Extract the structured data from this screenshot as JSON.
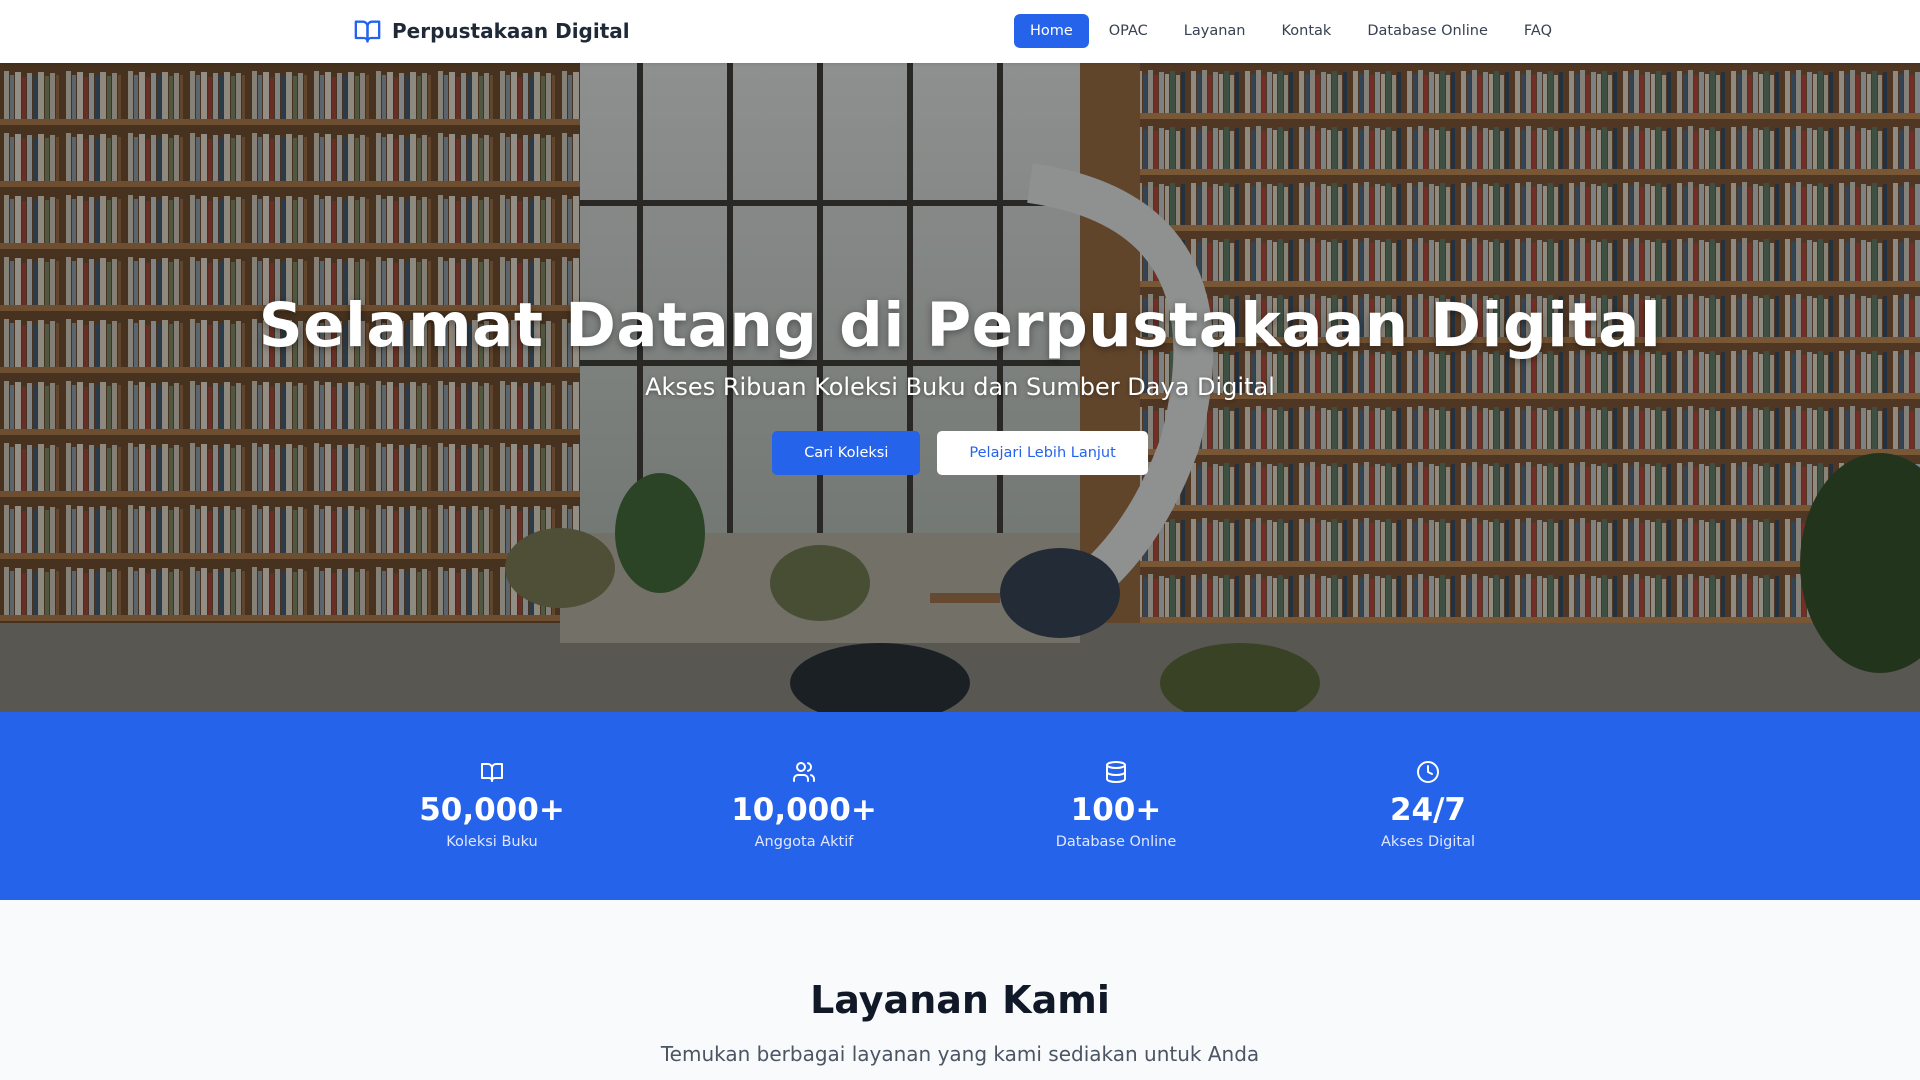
{
  "brand": {
    "name": "Perpustakaan Digital",
    "icon": "open-book-icon",
    "color": "#2563eb"
  },
  "nav": {
    "items": [
      {
        "label": "Home",
        "active": true
      },
      {
        "label": "OPAC",
        "active": false
      },
      {
        "label": "Layanan",
        "active": false
      },
      {
        "label": "Kontak",
        "active": false
      },
      {
        "label": "Database Online",
        "active": false
      },
      {
        "label": "FAQ",
        "active": false
      }
    ]
  },
  "hero": {
    "title": "Selamat Datang di Perpustakaan Digital",
    "subtitle": "Akses Ribuan Koleksi Buku dan Sumber Daya Digital",
    "primary_button": "Cari Koleksi",
    "secondary_button": "Pelajari Lebih Lanjut"
  },
  "stats": [
    {
      "icon": "book-icon",
      "value": "50,000+",
      "label": "Koleksi Buku"
    },
    {
      "icon": "users-icon",
      "value": "10,000+",
      "label": "Anggota Aktif"
    },
    {
      "icon": "database-icon",
      "value": "100+",
      "label": "Database Online"
    },
    {
      "icon": "clock-icon",
      "value": "24/7",
      "label": "Akses Digital"
    }
  ],
  "services": {
    "title": "Layanan Kami",
    "subtitle": "Temukan berbagai layanan yang kami sediakan untuk Anda"
  },
  "colors": {
    "accent": "#2563eb",
    "nav_text": "#374151",
    "heading": "#111827"
  }
}
